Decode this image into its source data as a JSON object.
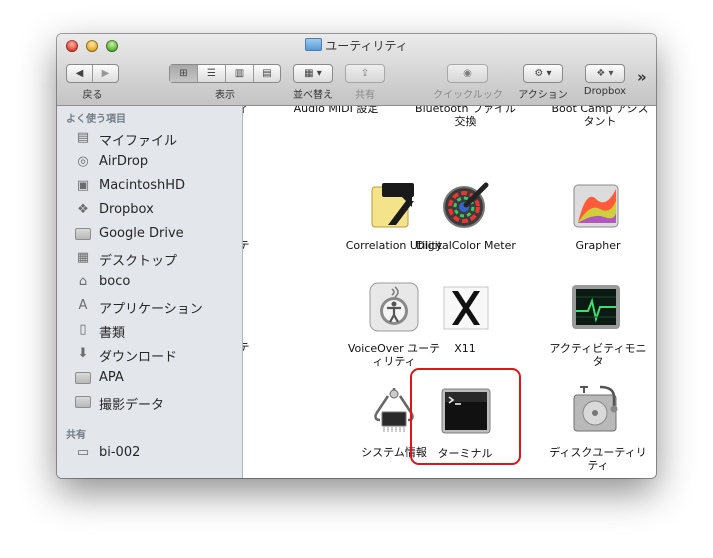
{
  "window": {
    "title": "ユーティリティ"
  },
  "toolbar": {
    "back_label": "戻る",
    "view_label": "表示",
    "arrange_label": "並べ替え",
    "share_label": "共有",
    "quicklook_label": "クイックルック",
    "action_label": "アクション",
    "dropbox_label": "Dropbox",
    "overflow_glyph": "»"
  },
  "sidebar": {
    "favorites_header": "よく使う項目",
    "favorites": [
      {
        "label": "マイファイル",
        "icon": "all-my-files-icon"
      },
      {
        "label": "AirDrop",
        "icon": "airdrop-icon"
      },
      {
        "label": "MacintoshHD",
        "icon": "hard-disk-icon"
      },
      {
        "label": "Dropbox",
        "icon": "dropbox-icon"
      },
      {
        "label": "Google Drive",
        "icon": "folder-icon"
      },
      {
        "label": "デスクトップ",
        "icon": "desktop-icon"
      },
      {
        "label": "boco",
        "icon": "home-icon"
      },
      {
        "label": "アプリケーション",
        "icon": "applications-icon"
      },
      {
        "label": "書類",
        "icon": "documents-icon"
      },
      {
        "label": "ダウンロード",
        "icon": "download-icon"
      },
      {
        "label": "APA",
        "icon": "folder-icon"
      },
      {
        "label": "撮影データ",
        "icon": "folder-icon"
      }
    ],
    "shared_header": "共有",
    "shared": [
      {
        "label": "bi-002",
        "icon": "computer-icon"
      }
    ]
  },
  "content": {
    "top_row": [
      {
        "line1": "ィ",
        "line2": ""
      },
      {
        "line1": "Audio MIDI 設定",
        "line2": ""
      },
      {
        "line1": "Bluetooth ファイル",
        "line2": "交換"
      },
      {
        "line1": "Boot Camp アシス",
        "line2": "タント"
      }
    ],
    "rows": [
      {
        "edge": "テ",
        "apps": [
          {
            "line1": "Correlation Utility",
            "line2": "",
            "icon": "correlation-utility-icon"
          },
          {
            "line1": "DigitalColor Meter",
            "line2": "",
            "icon": "digitalcolor-meter-icon"
          },
          {
            "line1": "Grapher",
            "line2": "",
            "icon": "grapher-icon"
          }
        ]
      },
      {
        "edge": "テ",
        "apps": [
          {
            "line1": "VoiceOver ユーテ",
            "line2": "ィリティ",
            "icon": "voiceover-utility-icon"
          },
          {
            "line1": "X11",
            "line2": "",
            "icon": "x11-icon"
          },
          {
            "line1": "アクティビティモニ",
            "line2": "タ",
            "icon": "activity-monitor-icon"
          }
        ]
      },
      {
        "edge": "",
        "apps": [
          {
            "line1": "システム情報",
            "line2": "",
            "icon": "system-information-icon"
          },
          {
            "line1": "ターミナル",
            "line2": "",
            "icon": "terminal-icon"
          },
          {
            "line1": "ディスクユーティリ",
            "line2": "ティ",
            "icon": "disk-utility-icon"
          }
        ]
      }
    ],
    "highlighted_app": "ターミナル"
  },
  "colors": {
    "highlight": "#e0151a",
    "sidebar_bg": "#e3e7ec"
  }
}
